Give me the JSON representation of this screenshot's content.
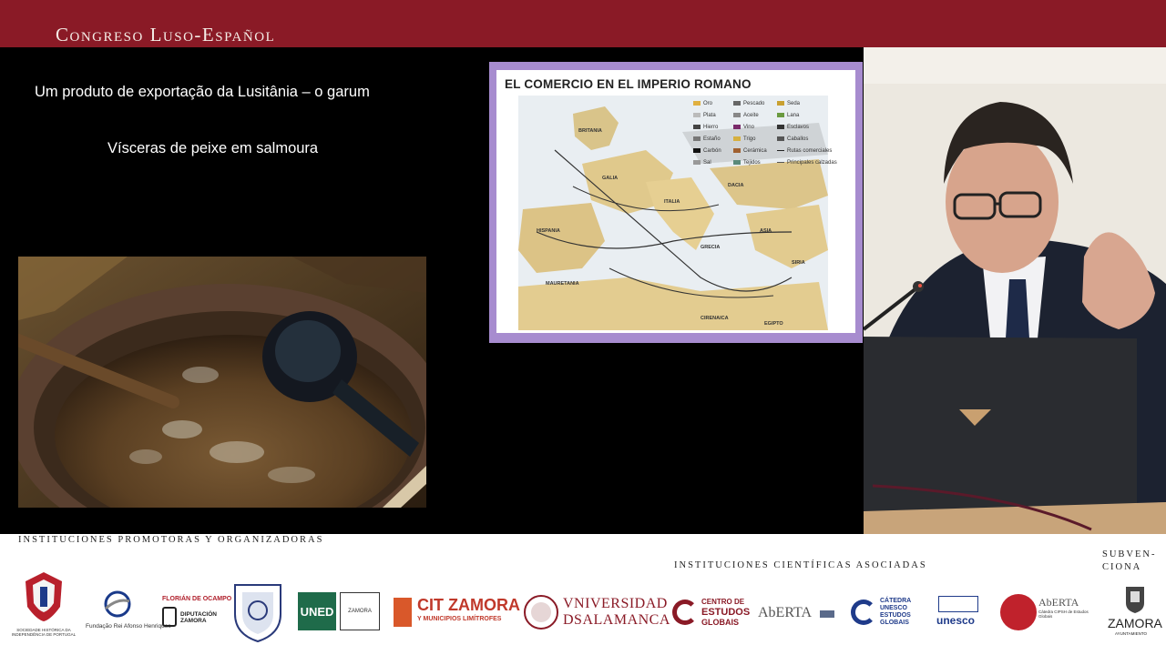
{
  "banner": {
    "title": "Congreso Luso-Español"
  },
  "slide": {
    "line1": "Um produto de exportação da Lusitânia – o garum",
    "line2": "Vísceras de peixe em salmoura",
    "map": {
      "title": "EL COMERCIO EN EL IMPERIO ROMANO",
      "legend": [
        "Oro",
        "Pescado",
        "Seda",
        "Plata",
        "Aceite",
        "Lana",
        "Hierro",
        "Vino",
        "Esclavos",
        "Estaño",
        "Trigo",
        "Caballos",
        "Carbón",
        "Cerámica",
        "Rutas comerciales",
        "Sal",
        "Tejidos",
        "Principales calzadas"
      ],
      "regions": [
        "BRITANIA",
        "GALIA",
        "HISPANIA",
        "MAURETANIA",
        "ITALIA",
        "DACIA",
        "GRECIA",
        "ASIA",
        "CIRENAICA",
        "EGIPTO",
        "SIRIA"
      ]
    }
  },
  "footer": {
    "promoters_heading": "Instituciones promotoras y organizadoras",
    "scientific_heading": "Instituciones científicas asociadas",
    "subvenciona_heading_1": "Subven-",
    "subvenciona_heading_2": "ciona",
    "logos": {
      "shp_caption": "SOCIEDADE HISTÓRICA DA INDEPENDÊNCIA DE PORTUGAL",
      "fundacao_caption": "Fundação Rei Afonso Henriques",
      "florian_top": "FLORIÁN DE OCAMPO",
      "florian_bottom": "DIPUTACIÓN ZAMORA",
      "uned": "UNED",
      "uned_zamora": "ZAMORA",
      "cit_main": "CIT ZAMORA",
      "cit_sub": "Y MUNICIPIOS LIMÍTROFES",
      "usal_1": "VNIVERSIDAD",
      "usal_2": "DSALAMANCA",
      "ceg_1": "CENTRO DE",
      "ceg_2": "ESTUDOS",
      "ceg_3": "GLOBAIS",
      "aberta": "AbERTA",
      "catedra_1": "CÁTEDRA",
      "catedra_2": "UNESCO",
      "catedra_3": "ESTUDOS",
      "catedra_4": "GLOBAIS",
      "unesco": "unesco",
      "aberta2": "AbERTA",
      "cipsh": "Cátedra CIPSH de Estudos Globais",
      "zamora": "ZAMORA",
      "zamora_sub": "AYUNTAMIENTO"
    }
  }
}
